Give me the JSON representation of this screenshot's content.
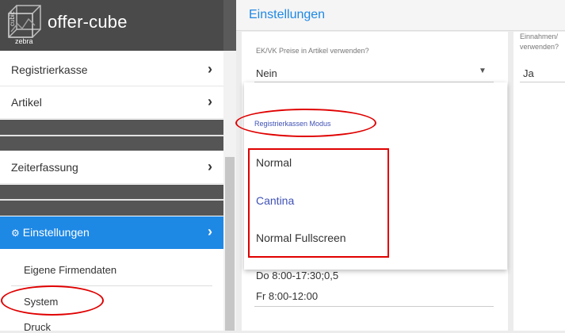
{
  "brand": {
    "logo_top": "cubic",
    "logo_bottom": "zebra",
    "app_name": "offer-cube"
  },
  "sidebar": {
    "items": [
      {
        "label": "Registrierkasse",
        "chevron": "›"
      },
      {
        "label": "Artikel",
        "chevron": "›"
      },
      {
        "label": "Zeiterfassung",
        "chevron": "›"
      },
      {
        "label": "Einstellungen",
        "chevron": "›"
      }
    ],
    "gear_icon": "⚙",
    "subitems": [
      "Eigene Firmendaten",
      "System",
      "Druck"
    ]
  },
  "header": {
    "title": "Einstellungen"
  },
  "settings": {
    "ekvk": {
      "label": "EK/VK Preise in Artikel verwenden?",
      "value": "Nein",
      "caret": "▼"
    },
    "right_field": {
      "label": "Einnahmen/\nverwenden?",
      "value": "Ja"
    },
    "hours": [
      "Do 8:00-17:30;0,5",
      "Fr 8:00-12:00"
    ]
  },
  "dropdown": {
    "title": "Registrierkassen Modus",
    "options": [
      "Normal",
      "Cantina",
      "Normal Fullscreen"
    ],
    "selected": "Cantina"
  },
  "colors": {
    "accent": "#1e88e5",
    "annotation": "#e00000",
    "brand_bg": "#4a4a4a",
    "option_selected": "#3f51b5"
  }
}
